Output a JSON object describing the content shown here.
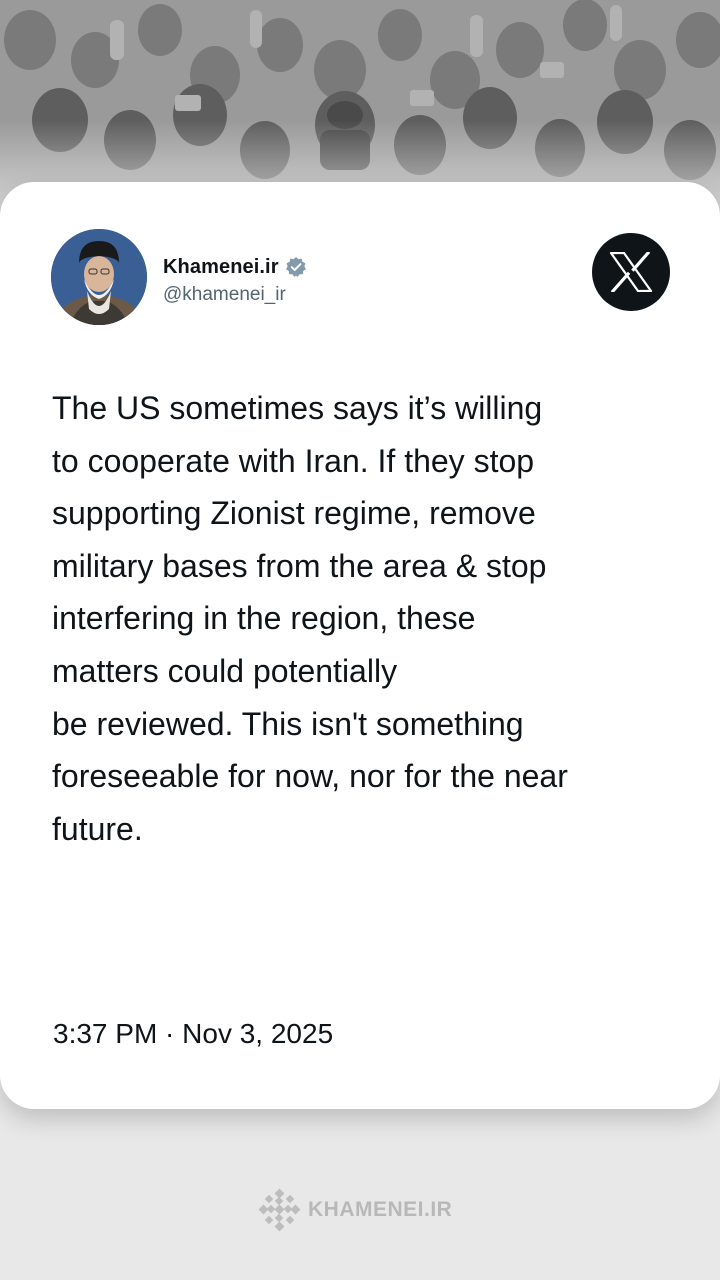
{
  "header_image": {
    "icon": "crowd-photo"
  },
  "tweet": {
    "display_name": "Khamenei.ir",
    "handle": "@khamenei_ir",
    "verified_icon": "verified-badge-icon",
    "avatar_icon": "profile-photo",
    "platform_icon": "x-logo-icon",
    "text": "The US sometimes says it’s willing\nto cooperate with Iran. If they stop\nsupporting Zionist regime, remove\nmilitary bases from the area & stop\ninterfering in the region, these\nmatters could potentially\nbe reviewed. This isn't something\nforeseeable for now, nor for the near\nfuture.",
    "timestamp": "3:37 PM · Nov 3, 2025"
  },
  "footer": {
    "brand_text": "KHAMENEI.IR",
    "brand_icon": "khamenei-logo-icon"
  },
  "colors": {
    "card_background": "#ffffff",
    "page_background": "#e8e8e8",
    "text_primary": "#0f1419",
    "text_secondary": "#536471",
    "verified_badge": "#829aab",
    "x_logo_background": "#0f1419",
    "footer_text": "#b8b8b8"
  }
}
